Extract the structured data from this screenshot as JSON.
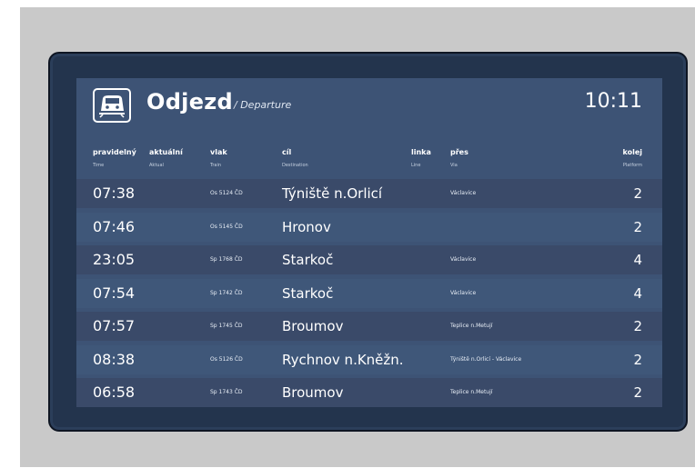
{
  "board": {
    "title": "Odjezd",
    "subtitle": "/ Departure",
    "clock": "10:11",
    "logo_icon": "train-front-icon",
    "colors": {
      "screen": "#3d5375",
      "row_dark": "#3a4a69",
      "row_light": "#3f5779",
      "bezel": "#23344d"
    }
  },
  "columns": [
    {
      "key": "scheduled",
      "label": "pravidelný",
      "sub": "Time"
    },
    {
      "key": "actual",
      "label": "aktuální",
      "sub": "Aktual"
    },
    {
      "key": "train",
      "label": "vlak",
      "sub": "Train"
    },
    {
      "key": "destination",
      "label": "cíl",
      "sub": "Destination"
    },
    {
      "key": "line",
      "label": "linka",
      "sub": "Line"
    },
    {
      "key": "via",
      "label": "přes",
      "sub": "Via"
    },
    {
      "key": "platform",
      "label": "kolej",
      "sub": "Platform"
    }
  ],
  "departures": [
    {
      "time": "07:38",
      "train": "Os 5124 ČD",
      "destination": "Týniště n.Orlicí",
      "via": "Václavice",
      "platform": "2"
    },
    {
      "time": "07:46",
      "train": "Os 5145 ČD",
      "destination": "Hronov",
      "via": "",
      "platform": "2"
    },
    {
      "time": "23:05",
      "train": "Sp 1768 ČD",
      "destination": "Starkoč",
      "via": "Václavice",
      "platform": "4"
    },
    {
      "time": "07:54",
      "train": "Sp 1742 ČD",
      "destination": "Starkoč",
      "via": "Václavice",
      "platform": "4"
    },
    {
      "time": "07:57",
      "train": "Sp 1745 ČD",
      "destination": "Broumov",
      "via": "Teplice n.Metují",
      "platform": "2"
    },
    {
      "time": "08:38",
      "train": "Os 5126 ČD",
      "destination": "Rychnov n.Kněžn.",
      "via": "Týniště n.Orlicí - Václavice",
      "platform": "2"
    },
    {
      "time": "06:58",
      "train": "Sp 1743 ČD",
      "destination": "Broumov",
      "via": "Teplice n.Metují",
      "platform": "2"
    }
  ]
}
